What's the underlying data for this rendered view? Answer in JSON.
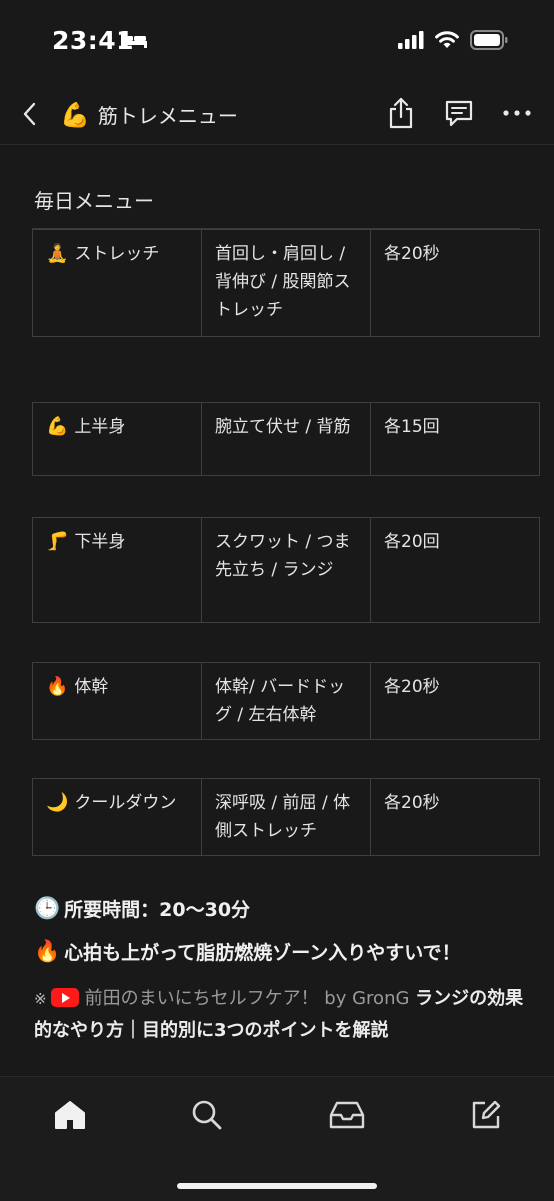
{
  "status_bar": {
    "time": "23:41"
  },
  "nav": {
    "title_emoji": "💪",
    "title": "筋トレメニュー"
  },
  "content": {
    "heading": "毎日メニュー",
    "rows": [
      {
        "emoji": "🧘",
        "category": "ストレッチ",
        "exercises": "首回し・肩回し / 背伸び / 股関節ストレッチ",
        "amount": "各20秒"
      },
      {
        "emoji": "💪",
        "category": "上半身",
        "exercises": "腕立て伏せ / 背筋",
        "amount": "各15回"
      },
      {
        "emoji": "🦵",
        "category": "下半身",
        "exercises": "スクワット / つま先立ち / ランジ",
        "amount": "各20回"
      },
      {
        "emoji": "🔥",
        "category": "体幹",
        "exercises": "体幹/ バードドッグ / 左右体幹",
        "amount": "各20秒"
      },
      {
        "emoji": "🌙",
        "category": "クールダウン",
        "exercises": "深呼吸 / 前屈 / 体側ストレッチ",
        "amount": "各20秒"
      }
    ],
    "time_note_emoji": "🕒",
    "time_note": "所要時間：20〜30分",
    "fat_note_emoji": "🔥",
    "fat_note": "心拍も上がって脂肪燃焼ゾーン入りやすいで！",
    "source_mark": "※",
    "source_channel": "前田のまいにちセルフケア！ by GronG",
    "source_title": "ランジの効果的なやり方｜目的別に3つのポイントを解説"
  },
  "icons": {
    "back": "chevron-left-icon",
    "share": "share-icon",
    "comment": "comment-icon",
    "more": "more-icon",
    "home": "home-icon",
    "search": "search-icon",
    "inbox": "inbox-icon",
    "compose": "compose-icon",
    "youtube": "youtube-icon"
  },
  "colors": {
    "background": "#191919",
    "text": "#e6e6e6",
    "border": "#3f3f3f",
    "youtube_red": "#ff1a1a"
  }
}
